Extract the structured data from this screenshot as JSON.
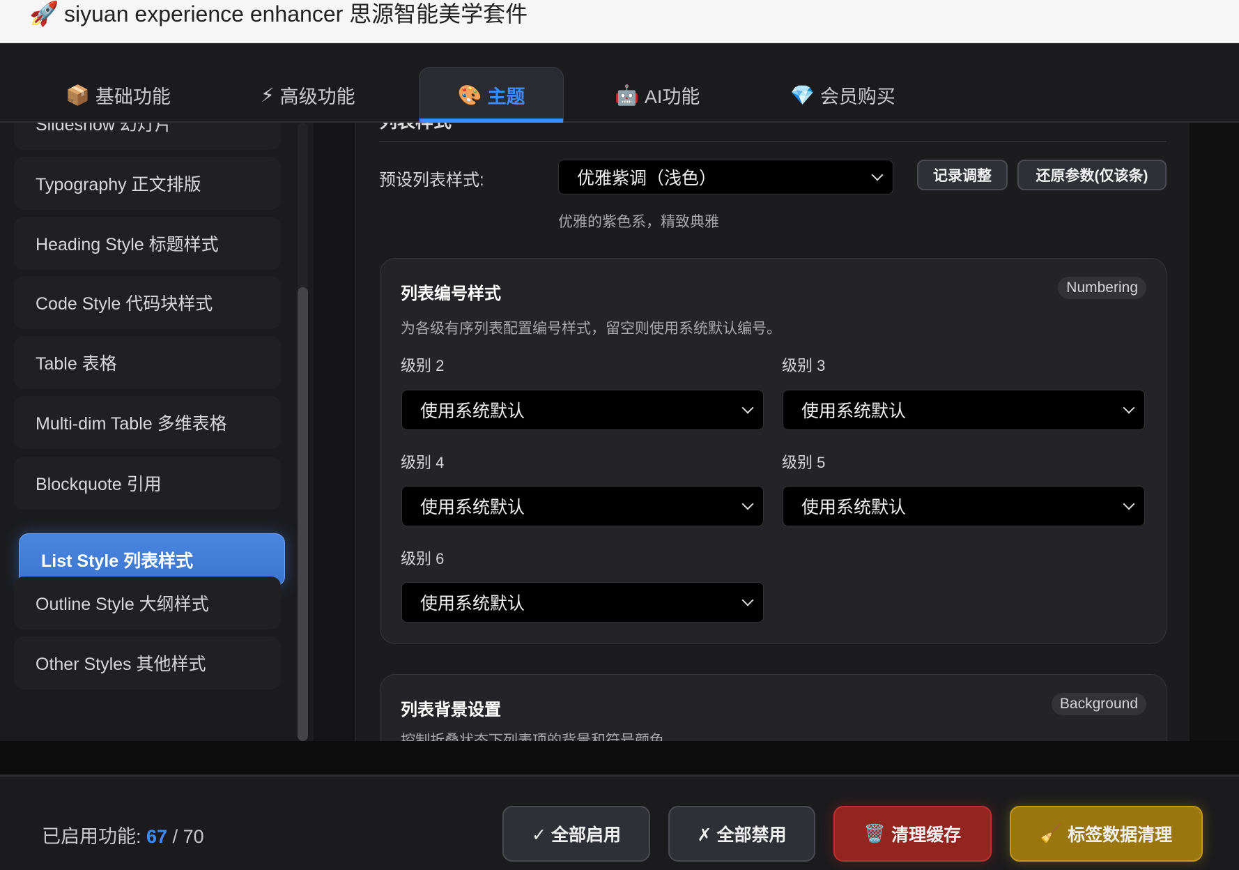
{
  "window": {
    "title": "siyuan experience enhancer 思源智能美学套件",
    "icon": "rocket-icon"
  },
  "tabs": [
    {
      "label": "基础功能",
      "icon": "📦"
    },
    {
      "label": "高级功能",
      "icon": "⚡"
    },
    {
      "label": "主题",
      "icon": "🎨",
      "active": true
    },
    {
      "label": "AI功能",
      "icon": "🤖"
    },
    {
      "label": "会员购买",
      "icon": "💎"
    }
  ],
  "sidebar": {
    "items": [
      {
        "label": "Slideshow 幻灯片"
      },
      {
        "label": "Typography 正文排版"
      },
      {
        "label": "Heading Style 标题样式"
      },
      {
        "label": "Code Style 代码块样式"
      },
      {
        "label": "Table 表格"
      },
      {
        "label": "Multi-dim Table 多维表格"
      },
      {
        "label": "Blockquote 引用"
      },
      {
        "label": "List Style 列表样式",
        "active": true
      },
      {
        "label": "Outline Style 大纲样式"
      },
      {
        "label": "Other Styles 其他样式"
      }
    ]
  },
  "main": {
    "section_title": "列表样式",
    "preset": {
      "label": "预设列表样式:",
      "value": "优雅紫调（浅色）",
      "hint": "优雅的紫色系，精致典雅",
      "record_button": "记录调整",
      "reset_button": "还原参数(仅该条)"
    },
    "numbering": {
      "title": "列表编号样式",
      "badge": "Numbering",
      "desc": "为各级有序列表配置编号样式，留空则使用系统默认编号。",
      "levels": [
        {
          "label": "级别 2",
          "value": "使用系统默认"
        },
        {
          "label": "级别 3",
          "value": "使用系统默认"
        },
        {
          "label": "级别 4",
          "value": "使用系统默认"
        },
        {
          "label": "级别 5",
          "value": "使用系统默认"
        },
        {
          "label": "级别 6",
          "value": "使用系统默认"
        }
      ]
    },
    "background": {
      "title": "列表背景设置",
      "badge": "Background",
      "desc": "控制折叠状态下列表项的背景和符号颜色"
    }
  },
  "footer": {
    "enabled_label": "已启用功能:",
    "enabled_count": "67",
    "separator": "/",
    "total": "70",
    "enable_all": "✓ 全部启用",
    "disable_all": "✗ 全部禁用",
    "clear_cache": "清理缓存",
    "clear_cache_icon": "🗑️",
    "tag_cleanup": "标签数据清理",
    "tag_cleanup_icon": "🧹"
  },
  "colors": {
    "accent": "#3d8bff",
    "danger": "#9a2323",
    "warning": "#a07a10"
  }
}
